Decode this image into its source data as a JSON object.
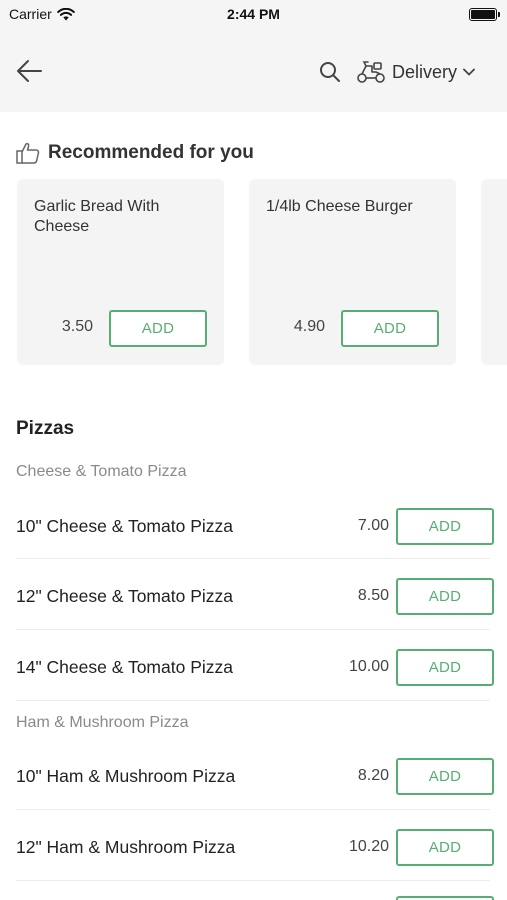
{
  "status_bar": {
    "carrier": "Carrier",
    "time": "2:44 PM",
    "battery_level": 1.0
  },
  "nav": {
    "back_icon": "back-arrow-icon",
    "search_icon": "search-icon",
    "mode_icon": "scooter-icon",
    "mode_label": "Delivery",
    "mode_chevron": "chevron-down-icon"
  },
  "recommended": {
    "title": "Recommended for you",
    "icon": "thumbs-up-icon",
    "items": [
      {
        "name": "Garlic Bread With Cheese",
        "price": "3.50",
        "add_label": "ADD"
      },
      {
        "name": "1/4lb Cheese Burger",
        "price": "4.90",
        "add_label": "ADD"
      }
    ]
  },
  "menu": {
    "section_title": "Pizzas",
    "groups": [
      {
        "title": "Cheese & Tomato Pizza",
        "items": [
          {
            "name": "10\" Cheese & Tomato Pizza",
            "price": "7.00",
            "add_label": "ADD"
          },
          {
            "name": "12\" Cheese & Tomato Pizza",
            "price": "8.50",
            "add_label": "ADD"
          },
          {
            "name": "14\" Cheese & Tomato Pizza",
            "price": "10.00",
            "add_label": "ADD"
          }
        ]
      },
      {
        "title": "Ham & Mushroom Pizza",
        "items": [
          {
            "name": "10\" Ham & Mushroom Pizza",
            "price": "8.20",
            "add_label": "ADD"
          },
          {
            "name": "12\" Ham & Mushroom Pizza",
            "price": "10.20",
            "add_label": "ADD"
          }
        ]
      }
    ]
  },
  "colors": {
    "accent": "#57ae72",
    "header_bg": "#f5f5f5",
    "card_bg": "#f4f4f4"
  }
}
